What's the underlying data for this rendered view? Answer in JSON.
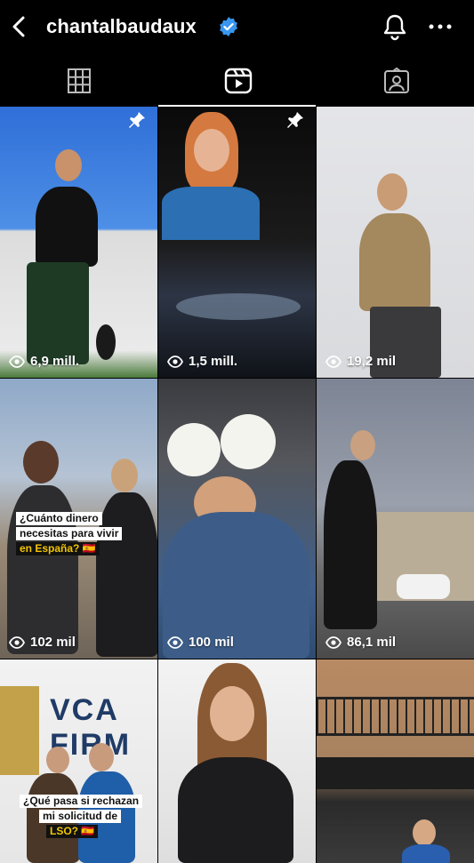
{
  "header": {
    "username": "chantalbaudaux",
    "icons": [
      "back-arrow-icon",
      "verified-badge-icon",
      "bell-icon",
      "more-icon"
    ]
  },
  "tabs": [
    {
      "name": "grid-icon",
      "active": false
    },
    {
      "name": "reels-icon",
      "active": true
    },
    {
      "name": "tagged-icon",
      "active": false
    }
  ],
  "tiles": [
    {
      "views": "6,9 mill.",
      "pinned": true
    },
    {
      "views": "1,5 mill.",
      "pinned": true
    },
    {
      "views": "19,2 mil",
      "pinned": false
    },
    {
      "views": "102 mil",
      "pinned": false,
      "overlay": [
        "¿Cuánto dinero",
        "necesitas para vivir",
        "en España? 🇪🇸"
      ]
    },
    {
      "views": "100 mil",
      "pinned": false
    },
    {
      "views": "86,1 mil",
      "pinned": false
    },
    {
      "views": "",
      "pinned": false,
      "overlay": [
        "¿Qué pasa si rechazan",
        "mi solicitud de",
        "LSO? 🇪🇸"
      ],
      "sign": "VCA FIRM"
    },
    {
      "views": "",
      "pinned": false
    },
    {
      "views": "",
      "pinned": false
    }
  ],
  "colors": {
    "background": "#000000",
    "verified": "#3897f0",
    "text": "#ffffff"
  }
}
